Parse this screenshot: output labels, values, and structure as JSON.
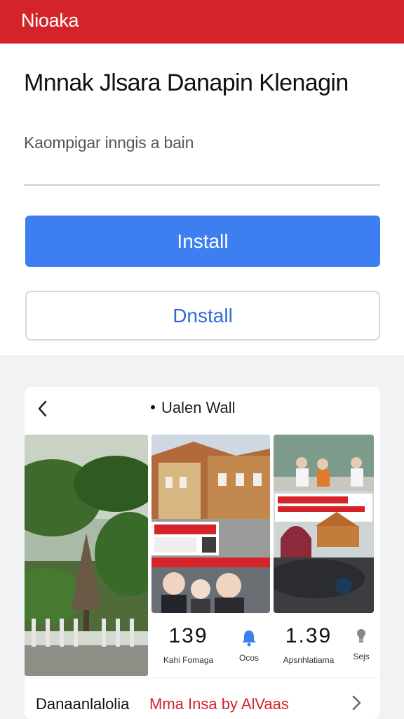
{
  "header": {
    "brand": "Nioaka"
  },
  "hero": {
    "title": "Mnnak Jlsara Danapin Klenagin",
    "subtitle": "Kaompigar inngis a bain",
    "install_primary_label": "Install",
    "install_secondary_label": "Dnstall"
  },
  "card": {
    "title": "Ualen Wall",
    "stats": [
      {
        "value": "139",
        "label": "Kahi Fomaga"
      },
      {
        "value": "",
        "label": "Ocos"
      },
      {
        "value": "1.39",
        "label": "Apsnhlatiama"
      },
      {
        "value": "",
        "label": "Sejs"
      }
    ],
    "footer_left": "Danaanlalolia",
    "footer_right": "Mma Insa by AlVaas"
  },
  "colors": {
    "brand_red": "#d4242a",
    "primary_blue": "#3d7ff0",
    "link_blue": "#2f6bd6"
  }
}
